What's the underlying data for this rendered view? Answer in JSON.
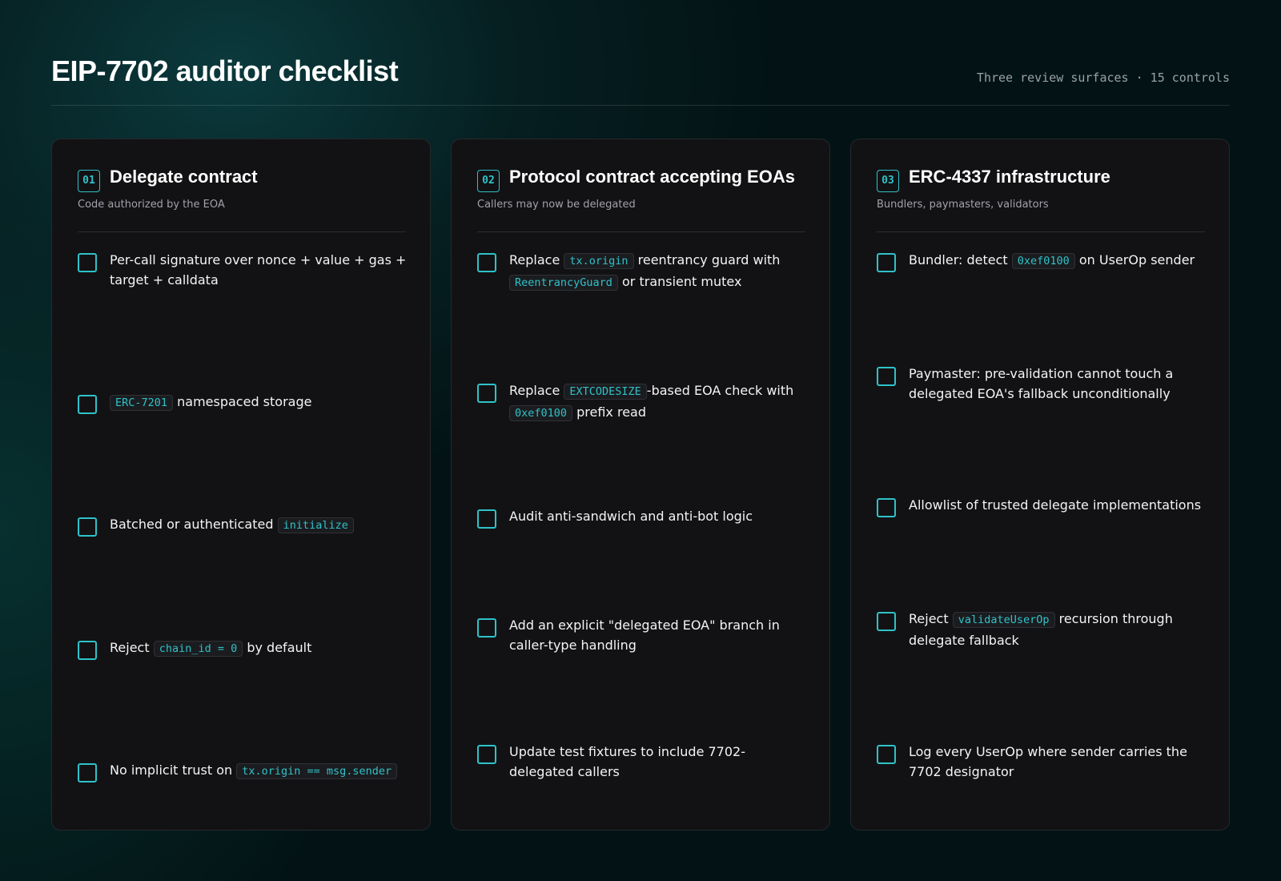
{
  "header": {
    "title": "EIP-7702 auditor checklist",
    "meta": "Three review surfaces · 15 controls"
  },
  "colors": {
    "accent": "#2fc2c9",
    "card_bg": "#121214",
    "page_bg": "#031315"
  },
  "icons": {
    "checkbox": "checkbox-icon"
  },
  "columns": [
    {
      "number": "01",
      "title": "Delegate contract",
      "subtitle": "Code authorized by the EOA",
      "items": [
        {
          "t1": "Per-call signature over nonce + value + gas + target + calldata",
          "checked": false
        },
        {
          "code1": "ERC-7201",
          "t1": "namespaced storage",
          "checked": false
        },
        {
          "t1": "Batched or authenticated",
          "code1": "initialize",
          "checked": false
        },
        {
          "t1": "Reject",
          "code1": "chain_id = 0",
          "t2": "by default",
          "checked": false
        },
        {
          "t1": "No implicit trust on",
          "code1": "tx.origin == msg.sender",
          "checked": false
        }
      ]
    },
    {
      "number": "02",
      "title": "Protocol contract accepting EOAs",
      "subtitle": "Callers may now be delegated",
      "items": [
        {
          "t1": "Replace",
          "code1": "tx.origin",
          "t2": "reentrancy guard with",
          "code2": "ReentrancyGuard",
          "t3": "or transient mutex",
          "checked": false
        },
        {
          "t1": "Replace",
          "code1": "EXTCODESIZE",
          "t2": "-based EOA check with",
          "code2": "0xef0100",
          "t3": "prefix read",
          "checked": false
        },
        {
          "t1": "Audit anti-sandwich and anti-bot logic",
          "checked": false
        },
        {
          "t1": "Add an explicit \"delegated EOA\" branch in caller-type handling",
          "checked": false
        },
        {
          "t1": "Update test fixtures to include 7702-delegated callers",
          "checked": false
        }
      ]
    },
    {
      "number": "03",
      "title": "ERC-4337 infrastructure",
      "subtitle": "Bundlers, paymasters, validators",
      "items": [
        {
          "t1": "Bundler: detect",
          "code1": "0xef0100",
          "t2": "on UserOp sender",
          "checked": false
        },
        {
          "t1": "Paymaster: pre-validation cannot touch a delegated EOA's fallback unconditionally",
          "checked": false
        },
        {
          "t1": "Allowlist of trusted delegate implementations",
          "checked": false
        },
        {
          "t1": "Reject",
          "code1": "validateUserOp",
          "t2": "recursion through delegate fallback",
          "checked": false
        },
        {
          "t1": "Log every UserOp where sender carries the 7702 designator",
          "checked": false
        }
      ]
    }
  ]
}
